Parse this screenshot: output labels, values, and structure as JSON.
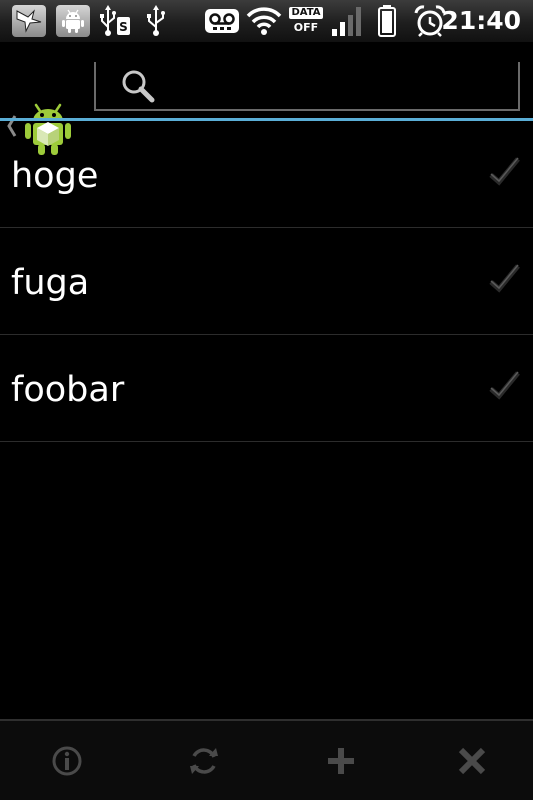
{
  "status_bar": {
    "time": "21:40",
    "data_badge_top": "DATA",
    "data_badge_bottom": "OFF",
    "icons": [
      "bird-notification-icon",
      "android-debug-icon",
      "usb-storage-icon",
      "usb-icon",
      "voicemail-icon",
      "wifi-icon",
      "data-off-icon",
      "signal-icon",
      "battery-icon",
      "alarm-icon"
    ]
  },
  "action_bar": {
    "search_placeholder": "",
    "accent_color": "#5aaed6"
  },
  "items": [
    {
      "label": "hoge",
      "checked": true
    },
    {
      "label": "fuga",
      "checked": true
    },
    {
      "label": "foobar",
      "checked": true
    }
  ],
  "bottom_bar": {
    "buttons": [
      "info-icon",
      "refresh-icon",
      "add-icon",
      "close-icon"
    ]
  }
}
